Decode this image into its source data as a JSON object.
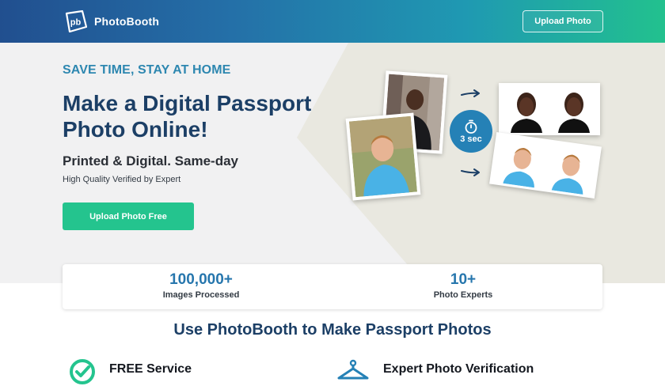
{
  "header": {
    "brand": "PhotoBooth",
    "logo_mark": "pb",
    "upload_label": "Upload Photo"
  },
  "hero": {
    "tagline": "SAVE TIME, STAY AT HOME",
    "headline": "Make a Digital Passport Photo Online!",
    "subhead": "Printed & Digital. Same-day",
    "smalltext": "High Quality Verified by Expert",
    "cta_label": "Upload Photo Free",
    "timer_label": "3 sec"
  },
  "stats": [
    {
      "value": "100,000+",
      "label": "Images Processed"
    },
    {
      "value": "10+",
      "label": "Photo Experts"
    }
  ],
  "section": {
    "title": "Use PhotoBooth to Make Passport Photos"
  },
  "features": [
    {
      "title": "FREE Service",
      "icon": "check-circle-icon"
    },
    {
      "title": "Expert Photo Verification",
      "icon": "hanger-icon"
    }
  ],
  "colors": {
    "accent_green": "#24c48e",
    "navy": "#1c3f66",
    "blue": "#2676ad",
    "header_start": "#214f8f",
    "header_end": "#22c18e"
  }
}
